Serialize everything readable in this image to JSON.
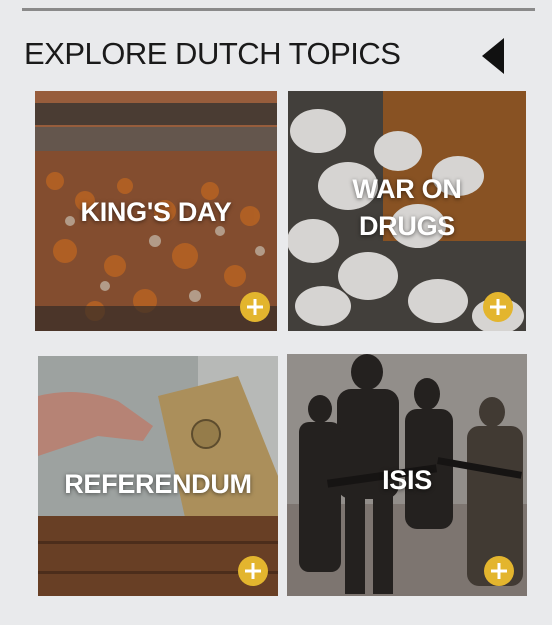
{
  "header": {
    "title": "EXPLORE DUTCH TOPICS",
    "back_icon": "triangle-left-icon"
  },
  "topics": [
    {
      "label": "KING'S DAY"
    },
    {
      "label_line1": "WAR ON",
      "label_line2": "DRUGS"
    },
    {
      "label": "REFERENDUM"
    },
    {
      "label": "ISIS"
    }
  ],
  "plus_icon": "plus-icon",
  "colors": {
    "background": "#e9eaec",
    "accent": "#e3b52e",
    "rule": "#8a8a8a",
    "title": "#1a1a1a"
  }
}
